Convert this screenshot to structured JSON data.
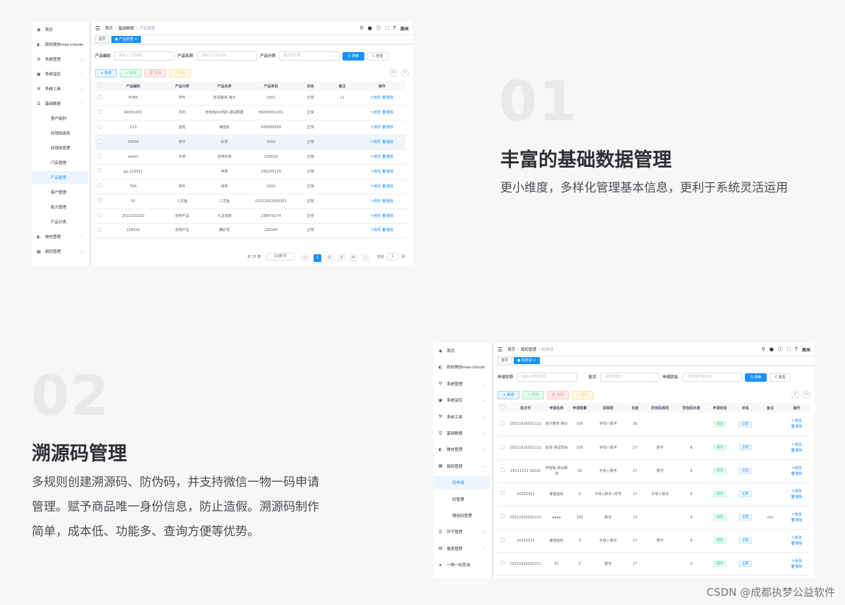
{
  "section1": {
    "number": "01",
    "title": "丰富的基础数据管理",
    "desc": "更小维度，多样化管理基本信息，更利于系统灵活运用"
  },
  "section2": {
    "number": "02",
    "title": "溯源码管理",
    "desc_lines": [
      "多规则创建溯源码、防伪码，并支持微信一物一码申请",
      "管理。赋予商品唯一身份信息，防止造假。溯源码制作",
      "简单，成本低、功能多、查询方便等优势。"
    ]
  },
  "watermark": "CSDN @成都执梦公益软件",
  "shot1": {
    "sidebar": [
      {
        "label": "首页",
        "icon": "dashboard-icon"
      },
      {
        "label": "政权微信mao-clouds",
        "icon": "wechat-icon"
      },
      {
        "label": "系统管理",
        "icon": "settings-icon",
        "arrow": true
      },
      {
        "label": "系统监控",
        "icon": "monitor-icon",
        "arrow": true
      },
      {
        "label": "系统工具",
        "icon": "tool-icon",
        "arrow": true
      },
      {
        "label": "基础数据",
        "icon": "list-icon",
        "arrow": true
      },
      {
        "label": "客户级别",
        "sub": true
      },
      {
        "label": "经销商级别",
        "sub": true
      },
      {
        "label": "经销商管理",
        "sub": true
      },
      {
        "label": "门店管理",
        "sub": true
      },
      {
        "label": "产品管理",
        "sub": true,
        "active": true
      },
      {
        "label": "客户管理",
        "sub": true
      },
      {
        "label": "批次管理",
        "sub": true
      },
      {
        "label": "产品分类",
        "sub": true
      },
      {
        "label": "微信管理",
        "icon": "wechat-icon",
        "arrow": true
      },
      {
        "label": "赋码管理",
        "icon": "code-icon",
        "arrow": true
      }
    ],
    "breadcrumb": [
      "首页",
      "基础数据",
      "产品管理"
    ],
    "toolbar_user": "商米",
    "tags": [
      "首页",
      "● 产品管理 ×"
    ],
    "filters": [
      {
        "label": "产品编码",
        "placeholder": "请输入产品编码"
      },
      {
        "label": "产品名称",
        "placeholder": "请输入产品名称"
      },
      {
        "label": "产品分类",
        "placeholder": "请选择分类"
      }
    ],
    "search_label": "Q 搜索",
    "reset_label": "C 重置",
    "actions": [
      "+ 新增",
      "✎ 修改",
      "🗑 删除",
      "⇩ 导出"
    ],
    "columns": [
      "",
      "产品编码",
      "产品分类",
      "产品名称",
      "产品条码",
      "状态",
      "备注",
      "操作"
    ],
    "rows": [
      [
        "PUER",
        "茶叶",
        "普洱春茶-演示",
        "1001",
        "正常",
        "11"
      ],
      [
        "A0001002",
        "饮料",
        "哇哈哈AD钙奶-测试数据",
        "69000001001",
        "正常",
        ""
      ],
      [
        "123",
        "齿轮",
        "梯齿轮",
        "909090909",
        "正常",
        ""
      ],
      [
        "10002",
        "茶叶",
        "红茶",
        "2002",
        "正常",
        ""
      ],
      [
        "watch",
        "手表",
        "佳明手表",
        "100010",
        "正常",
        ""
      ],
      [
        "pg-213551",
        "",
        "苹果",
        "256235123",
        "正常",
        ""
      ],
      [
        "TEA",
        "茶叶",
        "绿茶",
        "1003",
        "正常",
        ""
      ],
      [
        "01",
        "三文鱼",
        "三文鱼",
        "01012022030201",
        "正常",
        ""
      ],
      [
        "2022102233",
        "农特产品",
        "九龙花椒",
        "238479274",
        "正常",
        ""
      ],
      [
        "228342",
        "农特产品",
        "藏红花",
        "220345",
        "正常",
        ""
      ]
    ],
    "op_edit": "✎修改",
    "op_delete": "🗑删除",
    "pager": {
      "total": "共 37 条",
      "size": "10条/页",
      "pages": [
        "1",
        "2",
        "3",
        "4"
      ],
      "goto": "前往",
      "goto_val": "1",
      "page_suffix": "页"
    }
  },
  "shot2": {
    "sidebar": [
      {
        "label": "首页",
        "icon": "dashboard-icon"
      },
      {
        "label": "政权微信mao-clouds",
        "icon": "wechat-icon"
      },
      {
        "label": "系统管理",
        "icon": "settings-icon",
        "arrow": true
      },
      {
        "label": "系统监控",
        "icon": "monitor-icon",
        "arrow": true
      },
      {
        "label": "系统工具",
        "icon": "tool-icon",
        "arrow": true
      },
      {
        "label": "基础数据",
        "icon": "list-icon",
        "arrow": true
      },
      {
        "label": "微信管理",
        "icon": "wechat-icon",
        "arrow": true
      },
      {
        "label": "赋码管理",
        "icon": "code-icon",
        "arrow": true
      },
      {
        "label": "码申请",
        "sub": true,
        "active": true
      },
      {
        "label": "码管理",
        "sub": true
      },
      {
        "label": "微信码管理",
        "sub": true
      },
      {
        "label": "环节管理",
        "icon": "list-icon",
        "arrow": true
      },
      {
        "label": "报表管理",
        "icon": "report-icon",
        "arrow": true
      },
      {
        "label": "一物一码查询",
        "icon": "send-icon"
      }
    ],
    "breadcrumb": [
      "首页",
      "赋码管理",
      "码申请"
    ],
    "toolbar_user": "商米",
    "tags": [
      "首页",
      "● 码申请 ×"
    ],
    "filters": [
      {
        "label": "申请名称",
        "placeholder": "请输入申请名称"
      },
      {
        "label": "批次",
        "placeholder": "请选择批次"
      },
      {
        "label": "申请状态",
        "placeholder": "请选择申请状态"
      }
    ],
    "search_label": "Q 搜索",
    "reset_label": "C 重置",
    "actions": [
      "+ 新增",
      "✎ 修改",
      "🗑 删除",
      "⇩ 导出"
    ],
    "columns": [
      "",
      "批次号",
      "申请名称",
      "申请数量",
      "码规则",
      "长度",
      "防伪码规则",
      "防伪码长度",
      "申请状态",
      "状态",
      "备注",
      "操作"
    ],
    "rows": [
      [
        "20211016101111",
        "普尔春茶-演示",
        "100",
        "字母＋数字",
        "18",
        "",
        "",
        "成功",
        "正常",
        ""
      ],
      [
        "20211016101111",
        "普茶-测试防伪",
        "100",
        "字母＋数字",
        "17",
        "数字",
        "8",
        "成功",
        "正常",
        ""
      ],
      [
        "20111011 10222",
        "哇哈哈-测试推测",
        "20",
        "字母＋数字",
        "17",
        "数字",
        "6",
        "成功",
        "正常",
        ""
      ],
      [
        "20220321",
        "螺旋齿轮",
        "5",
        "字母+数字+符号",
        "17",
        "字母＋数字",
        "6",
        "成功",
        "正常",
        ""
      ],
      [
        "20211016101111",
        "aaaa",
        "100",
        "数字",
        "17",
        "",
        "0",
        "成功",
        "正常",
        "ces"
      ],
      [
        "20220322",
        "螺旋齿轮",
        "3",
        "字母＋数字",
        "17",
        "数字",
        "6",
        "成功",
        "正常",
        ""
      ],
      [
        "20211016101111",
        "55",
        "5",
        "数字",
        "17",
        "",
        "0",
        "成功",
        "正常",
        ""
      ]
    ],
    "op_edit": "✎修改",
    "op_delete": "🗑删除"
  }
}
